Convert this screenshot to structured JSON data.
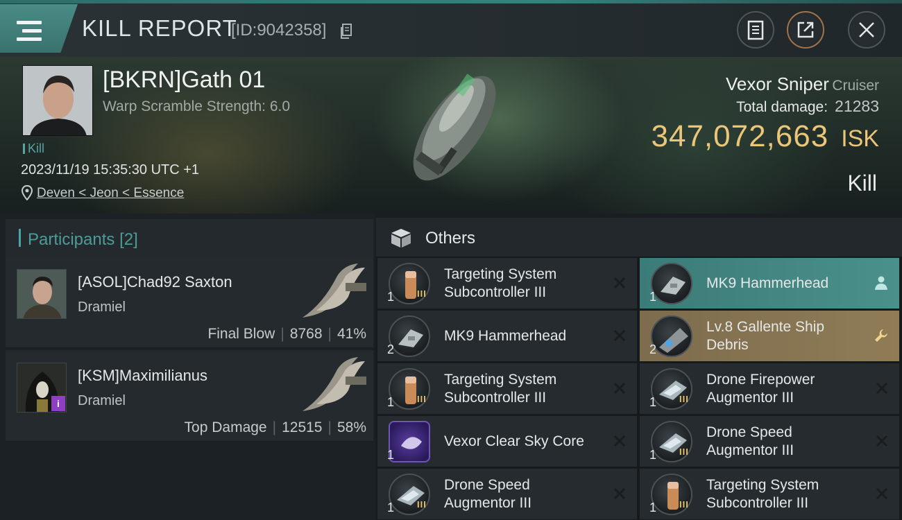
{
  "header": {
    "title": "KILL REPORT",
    "id_text": "[ID:9042358]"
  },
  "victim": {
    "name": "[BKRN]Gath 01",
    "warp_scramble": "Warp Scramble Strength: 6.0",
    "kill_tag": "Kill",
    "datetime": "2023/11/19 15:35:30 UTC +1",
    "location": "Deven < Jeon < Essence",
    "ship_name": "Vexor Sniper",
    "ship_class": "Cruiser",
    "total_damage_label": "Total damage:",
    "total_damage": "21283",
    "isk_value": "347,072,663",
    "isk_unit": "ISK",
    "result": "Kill"
  },
  "participants": {
    "title": "Participants",
    "count": "[2]",
    "list": [
      {
        "name": "[ASOL]Chad92 Saxton",
        "ship": "Dramiel",
        "role": "Final Blow",
        "damage": "8768",
        "percent": "41%"
      },
      {
        "name": "[KSM]Maximilianus",
        "ship": "Dramiel",
        "role": "Top Damage",
        "damage": "12515",
        "percent": "58%",
        "badge": "i"
      }
    ]
  },
  "others": {
    "title": "Others",
    "items": [
      {
        "name": "Targeting System Subcontroller III",
        "qty": "1",
        "meta": "III"
      },
      {
        "name": "MK9  Hammerhead",
        "qty": "1"
      },
      {
        "name": "MK9  Hammerhead",
        "qty": "2"
      },
      {
        "name": "Lv.8 Gallente Ship Debris",
        "qty": "2"
      },
      {
        "name": "Targeting System Subcontroller III",
        "qty": "1",
        "meta": "III"
      },
      {
        "name": "Drone Firepower Augmentor III",
        "qty": "1",
        "meta": "III"
      },
      {
        "name": "Vexor Clear Sky Core",
        "qty": "1"
      },
      {
        "name": "Drone Speed Augmentor III",
        "qty": "1",
        "meta": "III"
      },
      {
        "name": "Drone Speed Augmentor III",
        "qty": "1",
        "meta": "III"
      },
      {
        "name": "Targeting System Subcontroller III",
        "qty": "1",
        "meta": "III"
      }
    ]
  },
  "colors": {
    "accent_teal": "#4aa6a0",
    "isk_gold": "#ebc679",
    "badge_purple": "#8e3fc4"
  },
  "icons": [
    "menu-icon",
    "copy-icon",
    "clipboard-icon",
    "share-icon",
    "close-icon",
    "location-pin-icon",
    "box-icon",
    "remove-icon",
    "person-icon",
    "wrench-icon"
  ]
}
